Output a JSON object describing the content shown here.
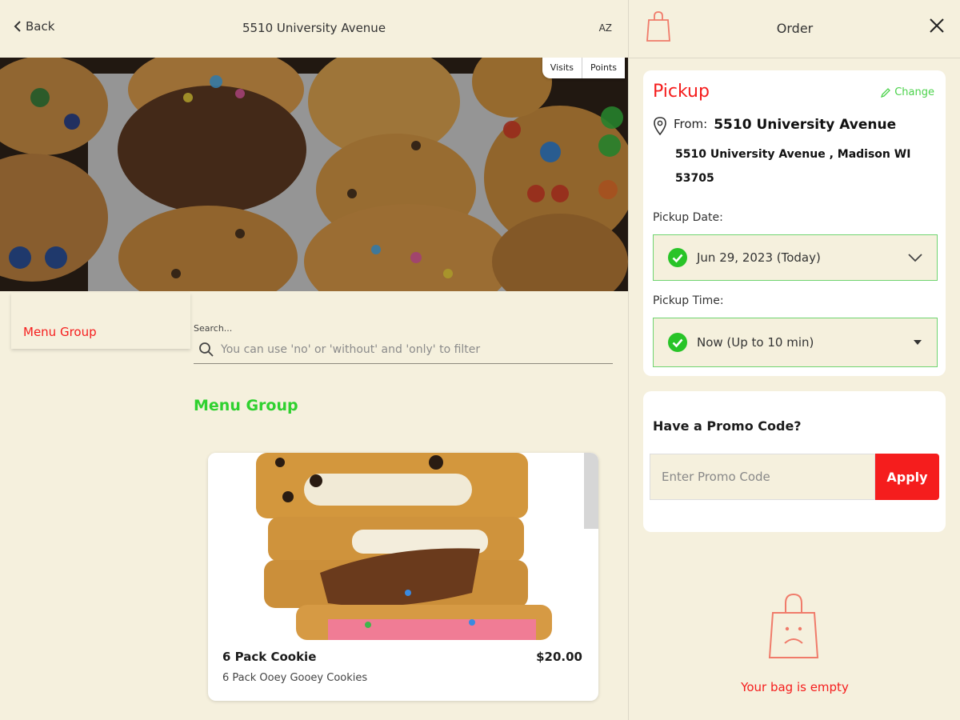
{
  "header": {
    "back_label": "Back",
    "title": "5510 University Avenue",
    "sort_label": "AZ"
  },
  "loyalty": {
    "visits_label": "Visits",
    "points_label": "Points"
  },
  "sidebar": {
    "group_item": "Menu Group"
  },
  "search": {
    "label": "Search...",
    "placeholder": "You can use 'no' or 'without' and 'only' to filter"
  },
  "menu": {
    "group_heading": "Menu Group",
    "items": [
      {
        "name": "6 Pack Cookie",
        "price": "$20.00",
        "description": "6 Pack Ooey Gooey Cookies"
      }
    ]
  },
  "order": {
    "title": "Order",
    "pickup_label": "Pickup",
    "change_label": "Change",
    "from_label": "From:",
    "location_name": "5510 University Avenue",
    "address_line1": "5510 University Avenue , Madison WI",
    "address_line2": "53705",
    "date_label": "Pickup Date:",
    "date_value": "Jun 29, 2023 (Today)",
    "time_label": "Pickup Time:",
    "time_value": "Now (Up to 10 min)",
    "promo_heading": "Have a Promo Code?",
    "promo_placeholder": "Enter Promo Code",
    "apply_label": "Apply",
    "empty_message": "Your bag is empty"
  },
  "colors": {
    "accent_red": "#f51d1d",
    "accent_green": "#2fd12f",
    "background": "#f5f0dd"
  }
}
